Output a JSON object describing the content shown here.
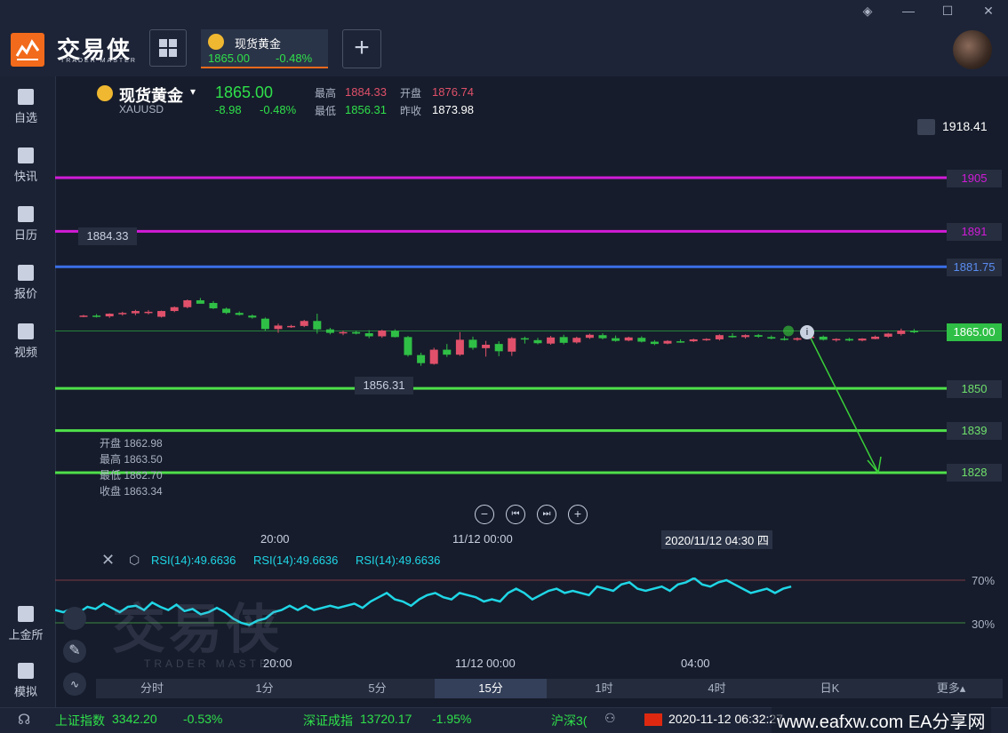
{
  "window": {
    "min_label": "—",
    "max_label": "☐",
    "close_label": "✕",
    "skin_label": "◈"
  },
  "brand": {
    "name": "交易侠",
    "sub": "TRADER MASTER"
  },
  "tab": {
    "name": "现货黄金",
    "price": "1865.00",
    "change": "-0.48%"
  },
  "sidebar": {
    "items": [
      {
        "label": "自选",
        "icon": "star-icon"
      },
      {
        "label": "快讯",
        "icon": "news-icon"
      },
      {
        "label": "日历",
        "icon": "calendar-icon"
      },
      {
        "label": "报价",
        "icon": "quote-icon"
      },
      {
        "label": "视频",
        "icon": "video-icon"
      },
      {
        "label": "上金所",
        "icon": "exchange-icon"
      },
      {
        "label": "模拟",
        "icon": "wallet-icon"
      }
    ]
  },
  "quote": {
    "name": "现货黄金",
    "code": "XAUUSD",
    "price": "1865.00",
    "chg": "-8.98",
    "pct": "-0.48%",
    "high_label": "最高",
    "high": "1884.33",
    "low_label": "最低",
    "low": "1856.31",
    "open_label": "开盘",
    "open": "1876.74",
    "prev_label": "昨收",
    "prev": "1873.98"
  },
  "levels": {
    "top": "1918.41",
    "l1905": "1905",
    "l1891": "1891",
    "l188175": "1881.75",
    "price": "1865.00",
    "l1850": "1850",
    "l1839": "1839",
    "l1828": "1828"
  },
  "annotations": {
    "high_mark": "1884.33",
    "low_mark": "1856.31"
  },
  "ohlc_box": {
    "open": "开盘 1862.98",
    "high": "最高 1863.50",
    "low": "最低 1862.70",
    "close": "收盘 1863.34"
  },
  "time_axis": {
    "t1": "20:00",
    "t2": "11/12 00:00",
    "t3": "2020/11/12 04:30 四"
  },
  "rsi": {
    "label1": "RSI(14):49.6636",
    "label2": "RSI(14):49.6636",
    "label3": "RSI(14):49.6636",
    "hi": "70%",
    "lo": "30%",
    "values": [
      42,
      40,
      43,
      40,
      45,
      43,
      48,
      44,
      40,
      45,
      46,
      42,
      49,
      45,
      42,
      47,
      41,
      43,
      38,
      40,
      44,
      40,
      34,
      30,
      28,
      32,
      34,
      40,
      42,
      46,
      42,
      46,
      42,
      44,
      46,
      44,
      46,
      48,
      44,
      50,
      54,
      58,
      52,
      50,
      46,
      52,
      56,
      58,
      54,
      52,
      58,
      56,
      54,
      50,
      52,
      50,
      58,
      62,
      58,
      52,
      56,
      60,
      62,
      58,
      60,
      58,
      56,
      64,
      62,
      60,
      66,
      68,
      62,
      60,
      62,
      64,
      60,
      66,
      68,
      72,
      66,
      64,
      68,
      70,
      66,
      62,
      58,
      60,
      62,
      58,
      62,
      64
    ]
  },
  "rsi_axis": {
    "t1": "20:00",
    "t2": "11/12 00:00",
    "t3": "04:00"
  },
  "periods": [
    "分时",
    "1分",
    "5分",
    "15分",
    "1时",
    "4时",
    "日K"
  ],
  "more_label": "更多▴",
  "statusbar": {
    "idx1_name": "上证指数",
    "idx1_val": "3342.20",
    "idx1_pct": "-0.53%",
    "idx2_name": "深证成指",
    "idx2_val": "13720.17",
    "idx2_pct": "-1.95%",
    "idx3_name": "沪深3(",
    "datetime": "2020-11-12 06:32:27",
    "watermark": "www.eafxw.com EA分享网"
  },
  "colors": {
    "up": "#e0506a",
    "down": "#2fbf46",
    "magenta": "#d21bd8",
    "blue": "#3a6fe8",
    "green_line": "#4fe04a",
    "accent": "#f26a1b"
  }
}
